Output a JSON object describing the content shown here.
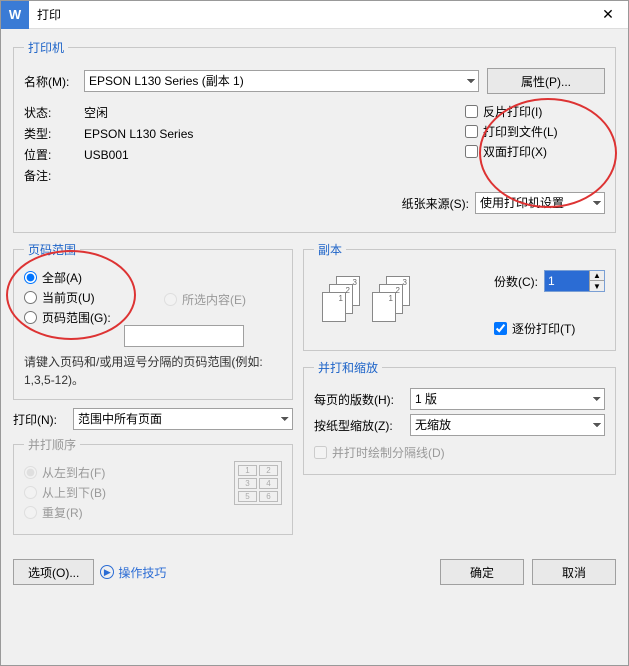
{
  "window": {
    "title": "打印",
    "icon_letter": "W"
  },
  "printer": {
    "legend": "打印机",
    "name_label": "名称(M):",
    "name_value": "EPSON L130 Series (副本 1)",
    "properties_btn": "属性(P)...",
    "status_label": "状态:",
    "status_value": "空闲",
    "type_label": "类型:",
    "type_value": "EPSON L130 Series",
    "location_label": "位置:",
    "location_value": "USB001",
    "remarks_label": "备注:",
    "reverse_print": "反片打印(I)",
    "print_to_file": "打印到文件(L)",
    "duplex": "双面打印(X)",
    "paper_source_label": "纸张来源(S):",
    "paper_source_value": "使用打印机设置"
  },
  "range": {
    "legend": "页码范围",
    "all": "全部(A)",
    "current": "当前页(U)",
    "selection": "所选内容(E)",
    "pages": "页码范围(G):",
    "hint": "请键入页码和/或用逗号分隔的页码范围(例如: 1,3,5-12)。"
  },
  "copies": {
    "legend": "副本",
    "count_label": "份数(C):",
    "count_value": "1",
    "collate": "逐份打印(T)"
  },
  "print": {
    "label": "打印(N):",
    "value": "范围中所有页面"
  },
  "order": {
    "legend": "并打顺序",
    "ltr": "从左到右(F)",
    "ttb": "从上到下(B)",
    "repeat": "重复(R)"
  },
  "scale": {
    "legend": "并打和缩放",
    "per_sheet_label": "每页的版数(H):",
    "per_sheet_value": "1 版",
    "paper_scale_label": "按纸型缩放(Z):",
    "paper_scale_value": "无缩放",
    "draw_border": "并打时绘制分隔线(D)"
  },
  "footer": {
    "options_btn": "选项(O)...",
    "tips": "操作技巧",
    "ok": "确定",
    "cancel": "取消"
  }
}
